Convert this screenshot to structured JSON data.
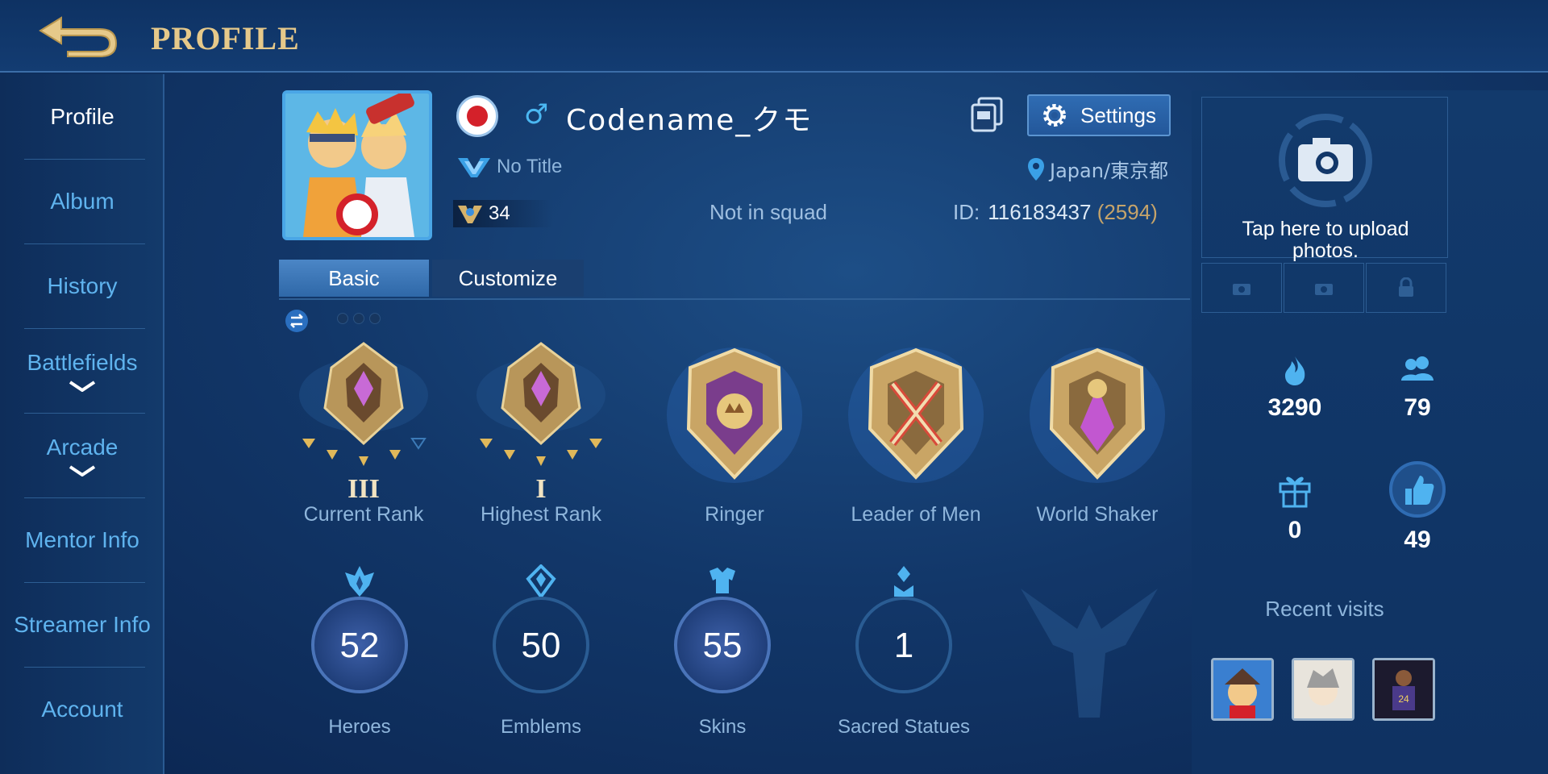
{
  "header": {
    "title": "PROFILE",
    "back_icon": "back-arrow-icon"
  },
  "sidebar": {
    "items": [
      {
        "label": "Profile",
        "active": true
      },
      {
        "label": "Album"
      },
      {
        "label": "History"
      },
      {
        "label": "Battlefields",
        "expandable": true
      },
      {
        "label": "Arcade",
        "expandable": true
      },
      {
        "label": "Mentor Info"
      },
      {
        "label": "Streamer Info"
      },
      {
        "label": "Account"
      }
    ]
  },
  "profile": {
    "name": "Codename_クモ",
    "gender_symbol": "♂",
    "title": "No Title",
    "level": "34",
    "squad": "Not in squad",
    "location": "Japan/東京都",
    "id_label": "ID:",
    "id_value": "116183437",
    "id_extra": "(2594)",
    "settings_label": "Settings"
  },
  "tabs": [
    {
      "label": "Basic",
      "active": true
    },
    {
      "label": "Customize",
      "active": false
    }
  ],
  "badges": [
    {
      "label": "Current Rank",
      "roman": "III"
    },
    {
      "label": "Highest Rank",
      "roman": "I"
    },
    {
      "label": "Ringer"
    },
    {
      "label": "Leader of Men"
    },
    {
      "label": "World Shaker"
    }
  ],
  "stats": [
    {
      "label": "Heroes",
      "value": "52"
    },
    {
      "label": "Emblems",
      "value": "50"
    },
    {
      "label": "Skins",
      "value": "55"
    },
    {
      "label": "Sacred Statues",
      "value": "1"
    }
  ],
  "right_panel": {
    "upload_text_line1": "Tap here to upload",
    "upload_text_line2": "photos.",
    "popularity": "3290",
    "followers": "79",
    "gifts": "0",
    "likes": "49",
    "recent_visits_label": "Recent visits"
  },
  "colors": {
    "accent_gold": "#e6c98a",
    "nav_text": "#5fb3ee",
    "label_text": "#8fb6dc"
  }
}
